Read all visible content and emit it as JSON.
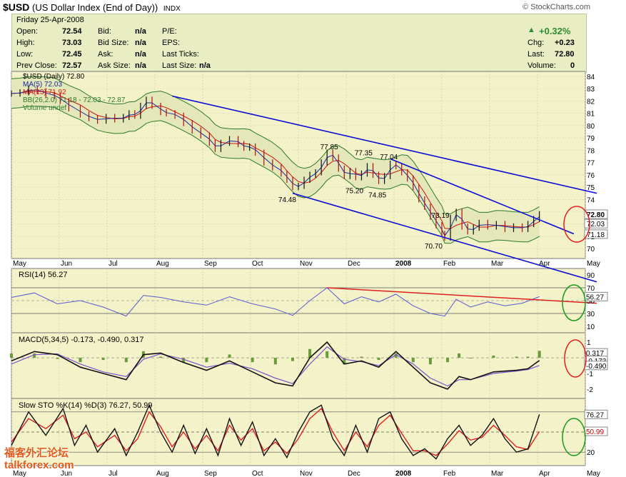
{
  "header": {
    "symbol": "$USD",
    "name": "(US Dollar Index (End of Day))",
    "exchange": "INDX",
    "watermark": "© StockCharts.com"
  },
  "quote": {
    "date": "Friday   25-Apr-2008",
    "open_label": "Open:",
    "open": "72.54",
    "high_label": "High:",
    "high": "73.03",
    "low_label": "Low:",
    "low": "72.45",
    "prev_label": "Prev Close:",
    "prev": "72.57",
    "bid_label": "Bid:",
    "bid": "n/a",
    "bidsize_label": "Bid Size:",
    "bidsize": "n/a",
    "ask_label": "Ask:",
    "ask": "n/a",
    "asksize_label": "Ask Size:",
    "asksize": "n/a",
    "pe_label": "P/E:",
    "eps_label": "EPS:",
    "lastticks_label": "Last Ticks:",
    "lastsize_label": "Last Size:",
    "lastsize": "n/a",
    "pct": "+0.32%",
    "chg_label": "Chg:",
    "chg": "+0.23",
    "last_label": "Last:",
    "last": "72.80",
    "vol_label": "Volume:",
    "vol": "0"
  },
  "colors": {
    "panel_bg": "#f4f2c9",
    "up": "#22a022",
    "price": "#000000",
    "ma5": "#1a2aa0",
    "ma13": "#d11a1a",
    "bb": "#2c7a2c",
    "trend": "#0b0bd4",
    "signal": "#e02020"
  },
  "chart_data": {
    "type": "line",
    "x_months": [
      "May",
      "Jun",
      "Jul",
      "Aug",
      "Sep",
      "Oct",
      "Nov",
      "Dec",
      "2008",
      "Feb",
      "Mar",
      "Apr",
      "May"
    ],
    "main": {
      "legend": [
        "$USD (Daily) 72.80",
        "MA(5) 72.03",
        "MA(13) 71.92",
        "BB(26,2.0) 71.18 - 72.03 - 72.87",
        "Volume undef"
      ],
      "ylim": [
        69.2,
        84.4
      ],
      "y_ticks": [
        84,
        83,
        82,
        81,
        80,
        79,
        78,
        77,
        76,
        75,
        74,
        73,
        72,
        71,
        70
      ],
      "right_labels": [
        "72.80",
        "72.03",
        "71.18"
      ],
      "annotations": [
        {
          "text": "77.85",
          "x": 0.553,
          "y": 77.85
        },
        {
          "text": "77.35",
          "x": 0.613,
          "y": 77.35
        },
        {
          "text": "77.04",
          "x": 0.657,
          "y": 77.04
        },
        {
          "text": "75.20",
          "x": 0.597,
          "y": 75.2
        },
        {
          "text": "74.85",
          "x": 0.637,
          "y": 74.85
        },
        {
          "text": "74.48",
          "x": 0.48,
          "y": 74.48
        },
        {
          "text": "73.19",
          "x": 0.747,
          "y": 73.19
        },
        {
          "text": "70.70",
          "x": 0.735,
          "y": 70.7
        }
      ],
      "close_points": [
        [
          0,
          82.6
        ],
        [
          0.015,
          82.7
        ],
        [
          0.03,
          83.0
        ],
        [
          0.045,
          82.8
        ],
        [
          0.06,
          82.5
        ],
        [
          0.075,
          82.4
        ],
        [
          0.085,
          82.0
        ],
        [
          0.1,
          81.4
        ],
        [
          0.12,
          80.9
        ],
        [
          0.135,
          80.6
        ],
        [
          0.15,
          80.4
        ],
        [
          0.165,
          80.7
        ],
        [
          0.18,
          80.5
        ],
        [
          0.195,
          80.7
        ],
        [
          0.205,
          81.0
        ],
        [
          0.215,
          80.8
        ],
        [
          0.225,
          81.6
        ],
        [
          0.235,
          82.1
        ],
        [
          0.245,
          81.6
        ],
        [
          0.26,
          81.1
        ],
        [
          0.27,
          81.0
        ],
        [
          0.285,
          80.8
        ],
        [
          0.3,
          80.2
        ],
        [
          0.315,
          79.6
        ],
        [
          0.33,
          79.2
        ],
        [
          0.345,
          78.6
        ],
        [
          0.355,
          78.1
        ],
        [
          0.365,
          78.6
        ],
        [
          0.38,
          78.9
        ],
        [
          0.395,
          78.5
        ],
        [
          0.405,
          78.2
        ],
        [
          0.415,
          78.3
        ],
        [
          0.425,
          77.8
        ],
        [
          0.44,
          77.0
        ],
        [
          0.455,
          76.6
        ],
        [
          0.47,
          76.1
        ],
        [
          0.48,
          75.6
        ],
        [
          0.49,
          75.0
        ],
        [
          0.5,
          75.1
        ],
        [
          0.51,
          75.6
        ],
        [
          0.52,
          76.0
        ],
        [
          0.53,
          76.2
        ],
        [
          0.54,
          77.0
        ],
        [
          0.55,
          77.8
        ],
        [
          0.56,
          77.4
        ],
        [
          0.57,
          76.5
        ],
        [
          0.58,
          75.9
        ],
        [
          0.59,
          76.3
        ],
        [
          0.6,
          75.8
        ],
        [
          0.61,
          76.1
        ],
        [
          0.62,
          76.7
        ],
        [
          0.63,
          76.0
        ],
        [
          0.64,
          75.5
        ],
        [
          0.65,
          75.9
        ],
        [
          0.66,
          76.9
        ],
        [
          0.67,
          76.7
        ],
        [
          0.68,
          76.2
        ],
        [
          0.69,
          75.7
        ],
        [
          0.7,
          75.0
        ],
        [
          0.71,
          74.0
        ],
        [
          0.72,
          73.4
        ],
        [
          0.73,
          72.6
        ],
        [
          0.74,
          71.9
        ],
        [
          0.75,
          71.2
        ],
        [
          0.755,
          70.9
        ],
        [
          0.765,
          72.5
        ],
        [
          0.775,
          73.0
        ],
        [
          0.785,
          71.8
        ],
        [
          0.795,
          71.4
        ],
        [
          0.805,
          71.7
        ],
        [
          0.815,
          72.1
        ],
        [
          0.83,
          71.8
        ],
        [
          0.845,
          72.0
        ],
        [
          0.86,
          71.6
        ],
        [
          0.875,
          71.8
        ],
        [
          0.89,
          71.6
        ],
        [
          0.9,
          72.0
        ],
        [
          0.91,
          72.4
        ],
        [
          0.92,
          72.8
        ]
      ],
      "trendlines": [
        {
          "from": [
            0.28,
            82.4
          ],
          "to": [
            1.02,
            74.5
          ]
        },
        {
          "from": [
            0.49,
            74.5
          ],
          "to": [
            1.02,
            67.3
          ]
        },
        {
          "from": [
            0.66,
            77.3
          ],
          "to": [
            0.98,
            71.2
          ]
        }
      ]
    },
    "rsi": {
      "legend": "RSI(14) 56.27",
      "ylim": [
        0,
        100
      ],
      "y_ticks": [
        "90",
        "70",
        "50",
        "30",
        "10"
      ],
      "last_label": "56.27",
      "points": [
        [
          0,
          55
        ],
        [
          0.04,
          62
        ],
        [
          0.08,
          45
        ],
        [
          0.12,
          50
        ],
        [
          0.16,
          40
        ],
        [
          0.2,
          26
        ],
        [
          0.23,
          58
        ],
        [
          0.26,
          55
        ],
        [
          0.3,
          48
        ],
        [
          0.34,
          43
        ],
        [
          0.38,
          56
        ],
        [
          0.42,
          45
        ],
        [
          0.46,
          37
        ],
        [
          0.49,
          27
        ],
        [
          0.52,
          50
        ],
        [
          0.55,
          70
        ],
        [
          0.58,
          45
        ],
        [
          0.61,
          56
        ],
        [
          0.64,
          48
        ],
        [
          0.67,
          60
        ],
        [
          0.7,
          42
        ],
        [
          0.73,
          30
        ],
        [
          0.755,
          26
        ],
        [
          0.775,
          52
        ],
        [
          0.8,
          40
        ],
        [
          0.83,
          48
        ],
        [
          0.86,
          42
        ],
        [
          0.89,
          46
        ],
        [
          0.92,
          56.27
        ]
      ],
      "redline": {
        "from": [
          0.55,
          70
        ],
        "to": [
          1.02,
          46
        ]
      }
    },
    "macd": {
      "legend": "MACD(5,34,5) -0.173, -0.490, 0.317",
      "ylim": [
        -2.6,
        1.6
      ],
      "y_ticks": [
        "1",
        "0",
        "-1",
        "-2"
      ],
      "last_labels": [
        "0.317",
        "-0.173",
        "-0.490"
      ],
      "macd_points": [
        [
          0,
          -0.2
        ],
        [
          0.04,
          0.4
        ],
        [
          0.08,
          0.2
        ],
        [
          0.12,
          -0.6
        ],
        [
          0.16,
          -1.0
        ],
        [
          0.2,
          -1.4
        ],
        [
          0.23,
          0.2
        ],
        [
          0.26,
          0.3
        ],
        [
          0.3,
          -0.3
        ],
        [
          0.34,
          -0.8
        ],
        [
          0.38,
          -0.2
        ],
        [
          0.42,
          -0.9
        ],
        [
          0.46,
          -1.6
        ],
        [
          0.49,
          -1.8
        ],
        [
          0.52,
          0.0
        ],
        [
          0.55,
          1.0
        ],
        [
          0.58,
          -0.4
        ],
        [
          0.61,
          -0.2
        ],
        [
          0.64,
          -0.6
        ],
        [
          0.67,
          0.4
        ],
        [
          0.7,
          -0.6
        ],
        [
          0.73,
          -1.6
        ],
        [
          0.76,
          -2.0
        ],
        [
          0.78,
          -1.2
        ],
        [
          0.8,
          -1.4
        ],
        [
          0.84,
          -0.9
        ],
        [
          0.88,
          -0.8
        ],
        [
          0.9,
          -0.7
        ],
        [
          0.92,
          -0.173
        ]
      ],
      "signal_points": [
        [
          0,
          -0.4
        ],
        [
          0.04,
          0.2
        ],
        [
          0.08,
          0.25
        ],
        [
          0.12,
          -0.4
        ],
        [
          0.16,
          -0.9
        ],
        [
          0.2,
          -1.2
        ],
        [
          0.23,
          -0.1
        ],
        [
          0.26,
          0.25
        ],
        [
          0.3,
          -0.1
        ],
        [
          0.34,
          -0.6
        ],
        [
          0.38,
          -0.35
        ],
        [
          0.42,
          -0.7
        ],
        [
          0.46,
          -1.3
        ],
        [
          0.49,
          -1.65
        ],
        [
          0.52,
          -0.4
        ],
        [
          0.55,
          0.7
        ],
        [
          0.58,
          -0.1
        ],
        [
          0.61,
          -0.25
        ],
        [
          0.64,
          -0.5
        ],
        [
          0.67,
          0.2
        ],
        [
          0.7,
          -0.4
        ],
        [
          0.73,
          -1.3
        ],
        [
          0.76,
          -1.8
        ],
        [
          0.78,
          -1.4
        ],
        [
          0.8,
          -1.4
        ],
        [
          0.84,
          -1.0
        ],
        [
          0.88,
          -0.85
        ],
        [
          0.9,
          -0.75
        ],
        [
          0.92,
          -0.49
        ]
      ]
    },
    "sto": {
      "legend": "Slow STO %K(14) %D(3) 76.27, 50.99",
      "ylim": [
        0,
        100
      ],
      "y_ticks": [
        "80",
        "50",
        "20"
      ],
      "last_labels": [
        "76.27",
        "50.99"
      ],
      "k_points": [
        [
          0,
          30
        ],
        [
          0.03,
          80
        ],
        [
          0.06,
          45
        ],
        [
          0.09,
          85
        ],
        [
          0.11,
          30
        ],
        [
          0.13,
          60
        ],
        [
          0.15,
          20
        ],
        [
          0.18,
          55
        ],
        [
          0.2,
          15
        ],
        [
          0.22,
          50
        ],
        [
          0.24,
          90
        ],
        [
          0.26,
          50
        ],
        [
          0.28,
          20
        ],
        [
          0.3,
          60
        ],
        [
          0.32,
          18
        ],
        [
          0.34,
          55
        ],
        [
          0.36,
          15
        ],
        [
          0.38,
          70
        ],
        [
          0.4,
          30
        ],
        [
          0.42,
          65
        ],
        [
          0.44,
          15
        ],
        [
          0.46,
          40
        ],
        [
          0.48,
          12
        ],
        [
          0.5,
          50
        ],
        [
          0.52,
          80
        ],
        [
          0.54,
          90
        ],
        [
          0.56,
          40
        ],
        [
          0.58,
          15
        ],
        [
          0.6,
          60
        ],
        [
          0.62,
          20
        ],
        [
          0.64,
          70
        ],
        [
          0.66,
          80
        ],
        [
          0.68,
          40
        ],
        [
          0.7,
          15
        ],
        [
          0.72,
          25
        ],
        [
          0.74,
          10
        ],
        [
          0.76,
          40
        ],
        [
          0.78,
          60
        ],
        [
          0.8,
          30
        ],
        [
          0.82,
          45
        ],
        [
          0.84,
          70
        ],
        [
          0.86,
          40
        ],
        [
          0.88,
          20
        ],
        [
          0.9,
          25
        ],
        [
          0.92,
          76.27
        ]
      ],
      "d_points": [
        [
          0,
          35
        ],
        [
          0.03,
          70
        ],
        [
          0.06,
          55
        ],
        [
          0.09,
          75
        ],
        [
          0.11,
          40
        ],
        [
          0.13,
          50
        ],
        [
          0.15,
          28
        ],
        [
          0.18,
          45
        ],
        [
          0.2,
          22
        ],
        [
          0.22,
          40
        ],
        [
          0.24,
          80
        ],
        [
          0.26,
          58
        ],
        [
          0.28,
          28
        ],
        [
          0.3,
          50
        ],
        [
          0.32,
          25
        ],
        [
          0.34,
          45
        ],
        [
          0.36,
          22
        ],
        [
          0.38,
          60
        ],
        [
          0.4,
          38
        ],
        [
          0.42,
          55
        ],
        [
          0.44,
          22
        ],
        [
          0.46,
          35
        ],
        [
          0.48,
          18
        ],
        [
          0.5,
          40
        ],
        [
          0.52,
          70
        ],
        [
          0.54,
          85
        ],
        [
          0.56,
          50
        ],
        [
          0.58,
          22
        ],
        [
          0.6,
          50
        ],
        [
          0.62,
          28
        ],
        [
          0.64,
          60
        ],
        [
          0.66,
          75
        ],
        [
          0.68,
          48
        ],
        [
          0.7,
          22
        ],
        [
          0.72,
          22
        ],
        [
          0.74,
          15
        ],
        [
          0.76,
          32
        ],
        [
          0.78,
          52
        ],
        [
          0.8,
          38
        ],
        [
          0.82,
          42
        ],
        [
          0.84,
          60
        ],
        [
          0.86,
          45
        ],
        [
          0.88,
          28
        ],
        [
          0.9,
          24
        ],
        [
          0.92,
          50.99
        ]
      ]
    }
  },
  "site_watermark": {
    "line1": "福客外汇论坛",
    "line2": "talkforex.com"
  }
}
